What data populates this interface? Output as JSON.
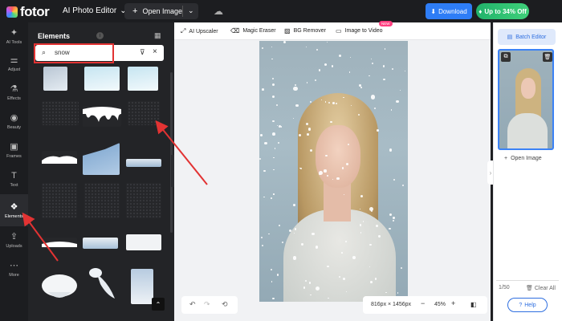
{
  "topbar": {
    "brand": "fotor",
    "app_menu": "AI Photo Editor",
    "open_image": "Open Image",
    "download": "Download",
    "promo": "Up to 34% Off"
  },
  "rail": [
    {
      "label": "AI Tools",
      "icon": "magic-wand-icon"
    },
    {
      "label": "Adjust",
      "icon": "sliders-icon"
    },
    {
      "label": "Effects",
      "icon": "flask-icon"
    },
    {
      "label": "Beauty",
      "icon": "eye-icon"
    },
    {
      "label": "Frames",
      "icon": "frame-icon"
    },
    {
      "label": "Text",
      "icon": "text-icon"
    },
    {
      "label": "Elements",
      "icon": "elements-icon"
    },
    {
      "label": "Uploads",
      "icon": "upload-icon"
    },
    {
      "label": "More",
      "icon": "more-icon"
    }
  ],
  "panel": {
    "title": "Elements",
    "search_value": "snow"
  },
  "tools": {
    "upscaler": "AI Upscaler",
    "eraser": "Magic Eraser",
    "bg_remover": "BG Remover",
    "image_to_video": "Image to Video",
    "new_badge": "NEW"
  },
  "canvas": {
    "dimensions": "816px × 1456px",
    "zoom": "45%"
  },
  "right_panel": {
    "batch_editor": "Batch Editor",
    "open_image": "Open Image",
    "count": "1/50",
    "clear_all": "Clear All",
    "help": "Help"
  },
  "colors": {
    "accent_blue": "#2e7df6",
    "promo_green": "#21b36b",
    "highlight_red": "#e23333"
  }
}
